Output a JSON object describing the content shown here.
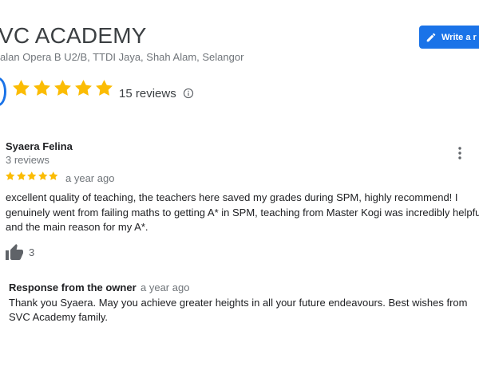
{
  "business": {
    "name": "VC ACADEMY",
    "address": "alan Opera B U2/B, TTDI Jaya, Shah Alam, Selangor",
    "write_review_label": "Write a r",
    "review_count": "15 reviews",
    "rating_stars": 5
  },
  "review": {
    "reviewer_name": "Syaera Felina",
    "reviewer_reviews": "3 reviews",
    "stars": 5,
    "date": "a year ago",
    "text": "excellent quality of teaching, the teachers here saved my grades during SPM, highly recommend! I genuinely went from failing maths to getting A* in SPM, teaching from Master Kogi was incredibly helpful and the main reason for my A*.",
    "likes": "3"
  },
  "owner_response": {
    "label": "Response from the owner",
    "date": "a year ago",
    "text": "Thank you Syaera. May you achieve greater heights in all your future endeavours. Best wishes from SVC Academy family."
  },
  "colors": {
    "accent": "#1a73e8",
    "star": "#fbbc04",
    "muted": "#70757a"
  },
  "icons": [
    "pencil-icon",
    "star-icon",
    "info-icon",
    "more-vert-icon",
    "thumb-up-icon"
  ]
}
